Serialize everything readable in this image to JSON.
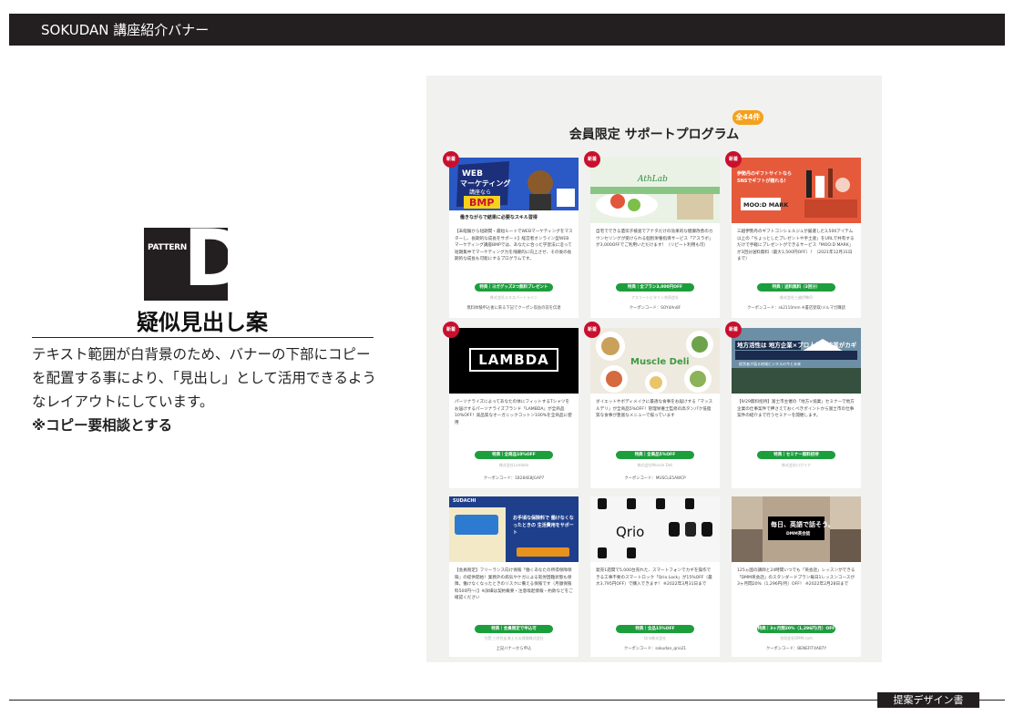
{
  "header": {
    "title": "SOKUDAN 講座紹介バナー"
  },
  "pattern": {
    "label": "PATTERN",
    "letter": "D",
    "heading": "疑似見出し案",
    "description": "テキスト範囲が白背景のため、バナーの下部にコピーを配置する事により、「見出し」として活用できるようなレイアウトにしています。",
    "note": "※コピー要相談とする"
  },
  "panel": {
    "title": "会員限定 サポートプログラム",
    "count_badge": "全44件",
    "new_label": "新着"
  },
  "cards": [
    {
      "brand": "WEBマーケティング講座なら BMP",
      "caption": "働きながらで結果に必要なスキル習得",
      "body": "【未経験から短期間・最短ルートでWEBマーケティングをマスターし、長期的な成長をサポート】経営者オンライン型WEBマーケティング講座BMPでは、あなたに合った学習法に沿って短期集中でマーケティング力を飛躍的に向上させ、その後の長期的な成長も可能にするプログラムです。",
      "promo": "特典｜ヨガグッズ2つ無料プレゼント",
      "company": "株式会社エキスパートライン",
      "coupon": "無料体験申込後に来る下記でクーポン収益の前を伝達",
      "new": true
    },
    {
      "brand": "AthLab",
      "caption": "",
      "body": "自宅でできる遺伝子検査でアナタだけの効果的な健康改善のカウンセリングが受けられる個別栄養指導サービス「アスラボ」が3,000OFFでご利用いただけます！（リピート利用も可）",
      "promo": "特典｜全プラン3,000円OFF",
      "company": "アスリートビタミン合同会社",
      "coupon": "クーポンコード：SOYdAn8F",
      "new": true
    },
    {
      "brand": "MOO:D MARK",
      "caption": "伊勢丹のギフトサイトなら SNSでギフトが贈れる!",
      "body": "三越伊勢丹のギフトコンシェルジュが厳選した3,500アイテム以上の「ちょっとしたプレゼントや手土産」をURLで共有するだけで手軽にプレゼントができるサービス「MOO:D MARK」が3回分送料無料（最大1,500円OFF）！（2021年12月31日まで）",
      "promo": "特典｜送料無料（3回分）",
      "company": "株式会社三越伊勢丹",
      "coupon": "クーポンコード：sk2110mm ※書店受取/メルマガ購読",
      "new": true
    },
    {
      "brand": "LAMBDA",
      "caption": "",
      "body": "パーソナライズによってあなたの体にフィットするTシャツをお届けするパーソナライズブランド「LAMBDA」が全商品10%OFF！高品質なオーガニックコットン100%を全商品に使用",
      "promo": "特典｜全商品10%OFF",
      "company": "株式会社Lambda",
      "coupon": "クーポンコード：1B284E8JGAP7",
      "new": true
    },
    {
      "brand": "Muscle Deli",
      "caption": "",
      "body": "ダイエットやボディメイクに最適な食事をお届けする「マッスルデリ」が全商品5%OFF！管理栄養士監修の高タンパク低脂質な食事が豊富なメニューで揃っています",
      "promo": "特典｜全商品5%OFF",
      "company": "株式会社Muscle Deli",
      "coupon": "クーポンコード：MUSCLE5AWCP",
      "new": true
    },
    {
      "brand": "地方活性は 地方企業×プロ人材の協業がカギ",
      "caption": "経営者が語る地域ビジネスの今と未来",
      "body": "【9/29無料招待】富士市主催の「地方×協業」セミナーで地方企業の仕事案件で押さえておくべきポイントから富士市の仕事案件の紹介まで行うセミナーを開催します。",
      "promo": "特典｜セミナー無料招待",
      "company": "株式会社ロガイア",
      "coupon": "",
      "new": true
    },
    {
      "brand": "SUDACHI",
      "caption": "お手頃な保険料で 働けなくなったときの 生活費用をサポート",
      "body": "【会員限定】フリーランス向け保険「働くあなたの所得保障保険」の提供開始！業務外の病気やケガによる就労困難状態も保障。働けなくなったときのリスクに備える保険です（月額保険料500円〜）】※詳細は契約概要・注意喚起情報・約款などをご確認ください",
      "promo": "特典｜会員限定で申込可",
      "company": "引受:三井住友海上火災保険株式会社",
      "coupon": "上記バナーから申込",
      "new": false
    },
    {
      "brand": "Qrio",
      "caption": "",
      "body": "発売1週間で5,000台売れた、スマートフォンでカギを操作できる工事不要のスマートロック「Qrio Lock」が15%OFF（最大3,795円OFF）で購入できます！ ※2022年3月31日まで",
      "promo": "特典｜全品15%OFF",
      "company": "Qrio株式会社",
      "coupon": "クーポンコード：sokudan_qrio21",
      "new": false
    },
    {
      "brand": "毎日、英語で話そう。",
      "caption": "DMM英会話",
      "body": "125ヵ国の講師と24時間いつでも「英会話」レッスンができる「DMM英会話」のスタンダードプラン毎日1レッスンコースが3ヶ月間20%（1,296円/月）OFF！ ※2022年2月28日まで",
      "promo": "特典｜3ヶ月間20%（1,296円/月）OFF",
      "company": "合同会社DMM.com",
      "coupon": "クーポンコード：BENEFIT4AB7Y",
      "new": false
    }
  ],
  "footer": {
    "tag": "提案デザイン書"
  },
  "colors": {
    "dark": "#231f20",
    "promo_green": "#1d9e3d",
    "new_red": "#c8102e",
    "badge_orange": "#f4a11d",
    "panel_bg": "#f1f1ef"
  }
}
